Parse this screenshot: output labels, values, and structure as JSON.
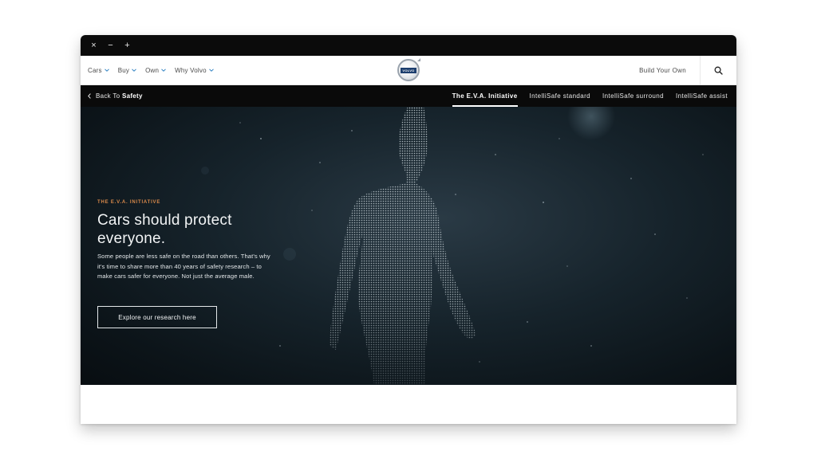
{
  "window": {
    "controls": [
      "×",
      "−",
      "+"
    ]
  },
  "topnav": {
    "items": [
      {
        "label": "Cars"
      },
      {
        "label": "Buy"
      },
      {
        "label": "Own"
      },
      {
        "label": "Why Volvo"
      }
    ],
    "logo_text": "VOLVO",
    "build_label": "Build Your Own",
    "search_icon": "search-icon"
  },
  "subnav": {
    "back_prefix": "Back To",
    "back_target": "Safety",
    "tabs": [
      {
        "label": "The E.V.A. Initiative",
        "active": true
      },
      {
        "label": "IntelliSafe standard",
        "active": false
      },
      {
        "label": "IntelliSafe surround",
        "active": false
      },
      {
        "label": "IntelliSafe assist",
        "active": false
      }
    ]
  },
  "hero": {
    "eyebrow": "THE E.V.A. INITIATIVE",
    "headline": "Cars should protect everyone.",
    "body": "Some people are less safe on the road than others. That's why it's time to share more than 40 years of safety research – to make cars safer for everyone. Not just the average male.",
    "cta_label": "Explore our research here"
  },
  "colors": {
    "titlebar": "#0b0b0b",
    "subnav": "#0a0a0a",
    "eyebrow": "#d9894a",
    "logo_blue": "#1c3e6e"
  }
}
